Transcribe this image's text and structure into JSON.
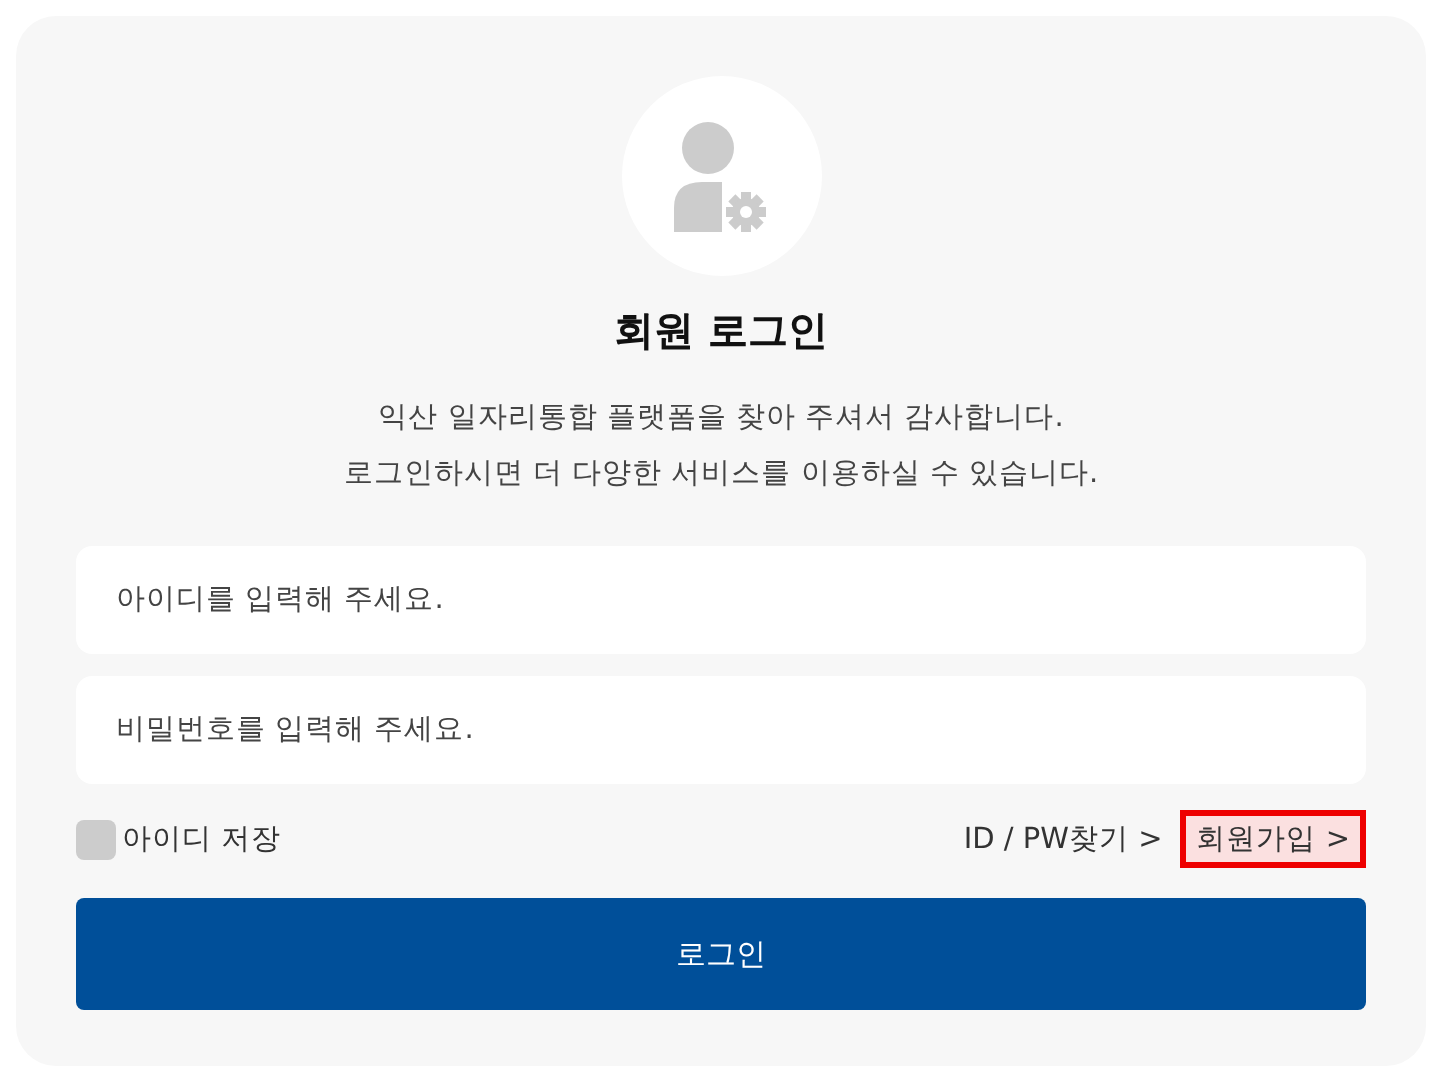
{
  "title": "회원 로그인",
  "description": [
    "익산 일자리통합 플랫폼을 찾아 주셔서 감사합니다.",
    "로그인하시면 더 다양한 서비스를 이용하실 수 있습니다."
  ],
  "fields": [
    {
      "placeholder": "아이디를 입력해 주세요."
    },
    {
      "placeholder": "비밀번호를 입력해 주세요."
    }
  ],
  "remember_id": {
    "label": "아이디 저장",
    "checked": false
  },
  "links": [
    {
      "label": "ID / PW찾기 >",
      "highlighted": false
    },
    {
      "label": "회원가입 >",
      "highlighted": true
    }
  ],
  "login_button": "로그인"
}
